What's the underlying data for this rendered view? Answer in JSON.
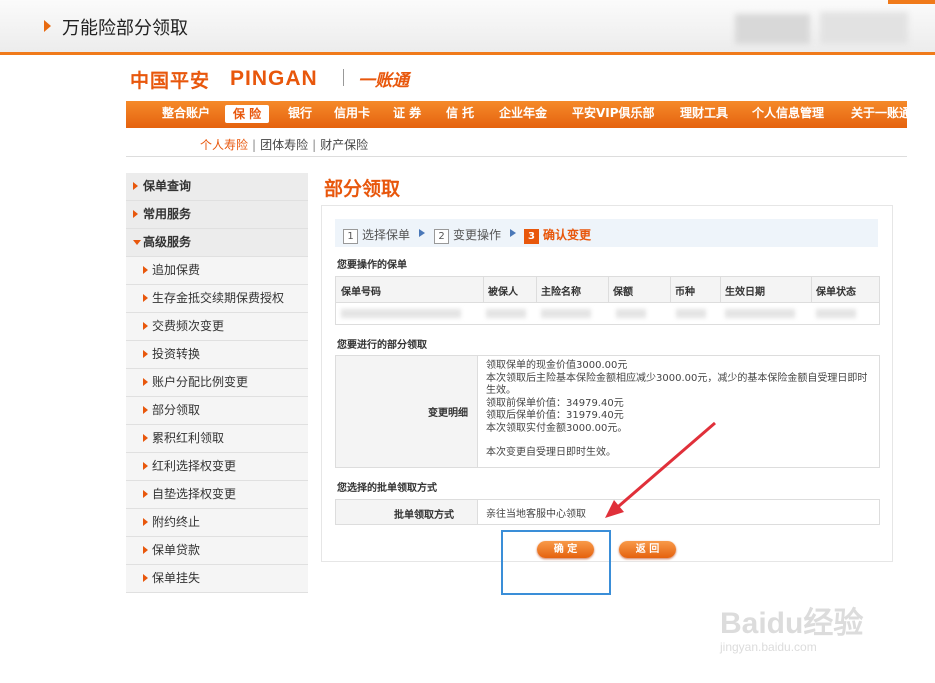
{
  "window": {
    "title": "万能险部分领取"
  },
  "logo": {
    "cn": "中国平安",
    "en": "PINGAN",
    "product": "一账通"
  },
  "nav": {
    "items": [
      "整合账户",
      "保 险",
      "银行",
      "信用卡",
      "证 券",
      "信 托",
      "企业年金",
      "平安VIP俱乐部",
      "理财工具",
      "个人信息管理",
      "关于一账通"
    ],
    "active": "保 险"
  },
  "subnav": {
    "items": [
      "个人寿险",
      "团体寿险",
      "财产保险"
    ],
    "current": "个人寿险",
    "separator": "|"
  },
  "sidebar": {
    "items": [
      {
        "label": "保单查询",
        "type": "head"
      },
      {
        "label": "常用服务",
        "type": "head"
      },
      {
        "label": "高级服务",
        "type": "head-open"
      },
      {
        "label": "追加保费",
        "type": "sub"
      },
      {
        "label": "生存金抵交续期保费授权",
        "type": "sub"
      },
      {
        "label": "交费频次变更",
        "type": "sub"
      },
      {
        "label": "投资转换",
        "type": "sub"
      },
      {
        "label": "账户分配比例变更",
        "type": "sub"
      },
      {
        "label": "部分领取",
        "type": "sub"
      },
      {
        "label": "累积红利领取",
        "type": "sub"
      },
      {
        "label": "红利选择权变更",
        "type": "sub"
      },
      {
        "label": "自垫选择权变更",
        "type": "sub"
      },
      {
        "label": "附约终止",
        "type": "sub"
      },
      {
        "label": "保单贷款",
        "type": "sub"
      },
      {
        "label": "保单挂失",
        "type": "sub"
      }
    ]
  },
  "main": {
    "title": "部分领取",
    "steps": [
      {
        "num": "1",
        "label": "选择保单"
      },
      {
        "num": "2",
        "label": "变更操作"
      },
      {
        "num": "3",
        "label": "确认变更"
      }
    ],
    "policy_section_title": "您要操作的保单",
    "policy_table": {
      "columns": [
        "保单号码",
        "被保人",
        "主险名称",
        "保额",
        "币种",
        "生效日期",
        "保单状态"
      ]
    },
    "withdraw_section_title": "您要进行的部分领取",
    "detail_label": "变更明细",
    "detail_lines": [
      "领取保单的现金价值3000.00元",
      "本次领取后主险基本保险金额相应减少3000.00元，减少的基本保险金额自受理日即时生效。",
      "领取前保单价值：34979.40元",
      "领取后保单价值：31979.40元",
      "本次领取实付金额3000.00元。",
      "",
      "本次变更自受理日即时生效。"
    ],
    "method_section_title": "您选择的批单领取方式",
    "method_label": "批单领取方式",
    "method_value": "亲往当地客服中心领取",
    "confirm_button": "确 定",
    "back_button": "返 回"
  },
  "watermark": {
    "brand": "Baidu经验",
    "url": "jingyan.baidu.com"
  },
  "colors": {
    "accent": "#e8570c",
    "nav": "#f07a1a",
    "highlight": "#3a8ed8",
    "arrow": "#e0303a"
  }
}
